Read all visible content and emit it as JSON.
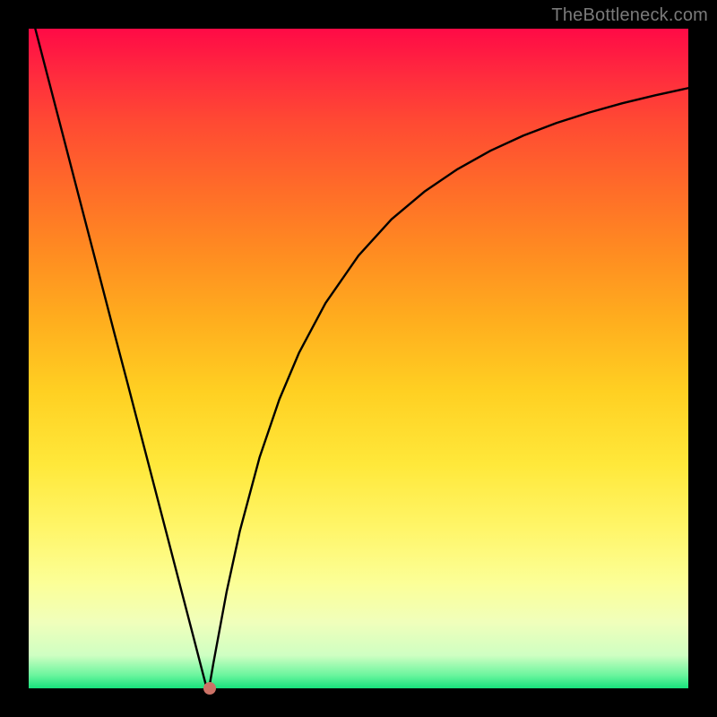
{
  "attribution": "TheBottleneck.com",
  "colors": {
    "frame": "#000000",
    "gradient_top": "#ff0a46",
    "gradient_bottom": "#17e27c",
    "curve": "#000000",
    "marker": "#cc7266",
    "attribution_text": "#7a7a7a"
  },
  "chart_data": {
    "type": "line",
    "title": "",
    "xlabel": "",
    "ylabel": "",
    "xlim": [
      0,
      100
    ],
    "ylim": [
      0,
      100
    ],
    "x": [
      1,
      3,
      5,
      7,
      9,
      11,
      13,
      15,
      17,
      19,
      21,
      23,
      25,
      26.5,
      27,
      27.5,
      28,
      30,
      32,
      35,
      38,
      41,
      45,
      50,
      55,
      60,
      65,
      70,
      75,
      80,
      85,
      90,
      95,
      100
    ],
    "y": [
      100,
      92.3,
      84.6,
      76.9,
      69.2,
      61.5,
      53.8,
      46.2,
      38.5,
      30.8,
      23.1,
      15.4,
      7.7,
      1.9,
      0,
      0.9,
      3.8,
      14.6,
      23.8,
      35.0,
      43.8,
      50.9,
      58.4,
      65.6,
      71.1,
      75.3,
      78.7,
      81.5,
      83.8,
      85.7,
      87.3,
      88.7,
      89.9,
      91.0
    ],
    "marker": {
      "x": 27.5,
      "y": 0
    },
    "notes": "V-shaped bottleneck curve. Y-axis represents mismatch/bottleneck percentage (0 at minimum, 100 at top). X-axis is an unlabeled component-performance dimension. Left branch is steep and linear; right branch rises with diminishing slope. Background vertical gradient encodes the same severity scale (green at bottom → red at top)."
  }
}
